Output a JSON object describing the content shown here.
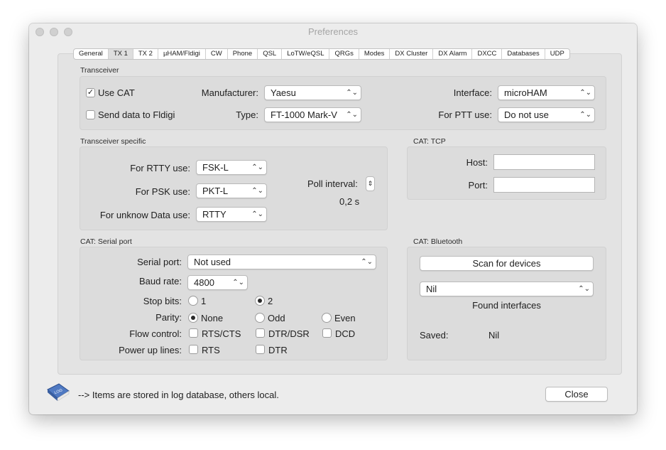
{
  "window": {
    "title": "Preferences"
  },
  "tabs": [
    "General",
    "TX 1",
    "TX 2",
    "µHAM/Fldigi",
    "CW",
    "Phone",
    "QSL",
    "LoTW/eQSL",
    "QRGs",
    "Modes",
    "DX Cluster",
    "DX Alarm",
    "DXCC",
    "Databases",
    "UDP"
  ],
  "active_tab": "TX 1",
  "transceiver": {
    "title": "Transceiver",
    "use_cat_label": "Use CAT",
    "use_cat_checked": true,
    "send_fldigi_label": "Send data to Fldigi",
    "send_fldigi_checked": false,
    "manufacturer_label": "Manufacturer:",
    "manufacturer_value": "Yaesu",
    "type_label": "Type:",
    "type_value": "FT-1000 Mark-V",
    "interface_label": "Interface:",
    "interface_value": "microHAM",
    "ptt_label": "For PTT use:",
    "ptt_value": "Do not use"
  },
  "specific": {
    "title": "Transceiver specific",
    "rtty_label": "For RTTY use:",
    "rtty_value": "FSK-L",
    "psk_label": "For PSK use:",
    "psk_value": "PKT-L",
    "unknown_label": "For unknow Data use:",
    "unknown_value": "RTTY",
    "poll_label": "Poll interval:",
    "poll_value": "0,2 s"
  },
  "tcp": {
    "title": "CAT: TCP",
    "host_label": "Host:",
    "host_value": "",
    "port_label": "Port:",
    "port_value": ""
  },
  "serial": {
    "title": "CAT: Serial port",
    "port_label": "Serial port:",
    "port_value": "Not used",
    "baud_label": "Baud rate:",
    "baud_value": "4800",
    "stop_label": "Stop bits:",
    "stop_options": [
      "1",
      "2"
    ],
    "stop_selected": "2",
    "parity_label": "Parity:",
    "parity_options": [
      "None",
      "Odd",
      "Even"
    ],
    "parity_selected": "None",
    "flow_label": "Flow control:",
    "flow_options": [
      "RTS/CTS",
      "DTR/DSR",
      "DCD"
    ],
    "power_label": "Power up lines:",
    "power_options": [
      "RTS",
      "DTR"
    ]
  },
  "bluetooth": {
    "title": "CAT: Bluetooth",
    "scan_label": "Scan for devices",
    "interfaces_value": "Nil",
    "found_label": "Found interfaces",
    "saved_label": "Saved:",
    "saved_value": "Nil"
  },
  "footer": {
    "note": "--> Items are stored in log database, others local.",
    "close_label": "Close",
    "logo_text": "LOG"
  }
}
